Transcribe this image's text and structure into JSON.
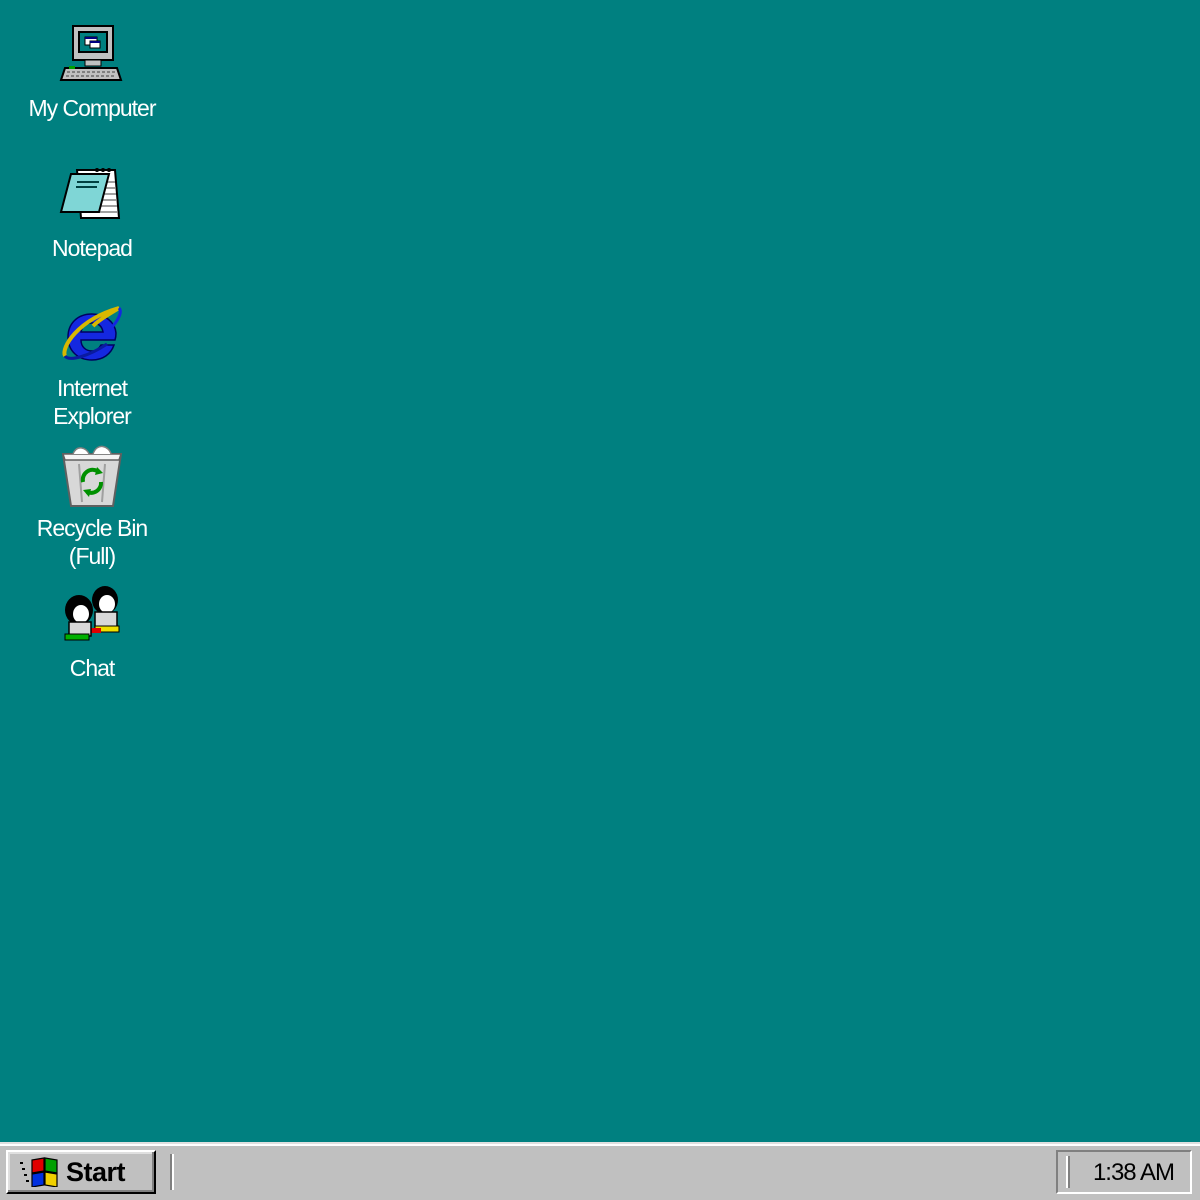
{
  "desktop": {
    "background_color": "#008080",
    "icons": [
      {
        "label": "My Computer",
        "icon": "my-computer-icon"
      },
      {
        "label": "Notepad",
        "icon": "notepad-icon"
      },
      {
        "label": "Internet\nExplorer",
        "icon": "internet-explorer-icon"
      },
      {
        "label": "Recycle Bin\n(Full)",
        "icon": "recycle-bin-full-icon"
      },
      {
        "label": "Chat",
        "icon": "chat-icon"
      }
    ]
  },
  "taskbar": {
    "start_label": "Start",
    "start_icon": "windows-logo-icon",
    "clock": "1:38 AM"
  }
}
